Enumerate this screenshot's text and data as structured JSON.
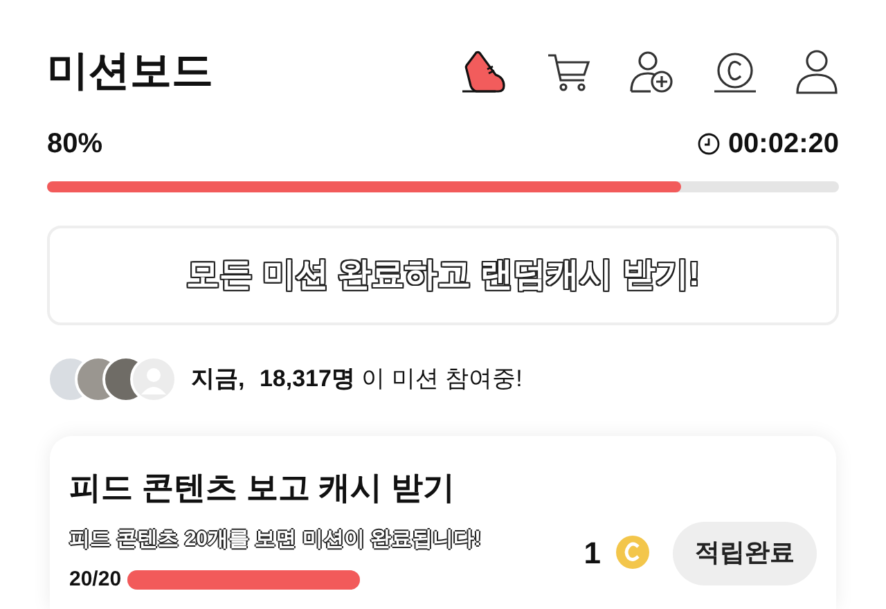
{
  "header": {
    "title": "미션보드"
  },
  "progress": {
    "percent": "80%",
    "level": 0.8,
    "timer": "00:02:20"
  },
  "banner": {
    "text": "모든 미션 완료하고 랜덤캐시 받기!"
  },
  "participants": {
    "avatars": [
      {
        "kind": "photo"
      },
      {
        "kind": "photo"
      },
      {
        "kind": "photo"
      },
      {
        "kind": "silhouette"
      }
    ],
    "prefix": "지금,",
    "count": "18,317명",
    "suffix": "이 미션 참여중!"
  },
  "missions": [
    {
      "title": "피드 콘텐츠 보고 캐시 받기",
      "description": "피드 콘텐츠 20개를 보면 미션이 완료됩니다!",
      "reward": "1",
      "button": "적립완료",
      "done": true,
      "count": "20/20",
      "level": 1
    }
  ]
}
